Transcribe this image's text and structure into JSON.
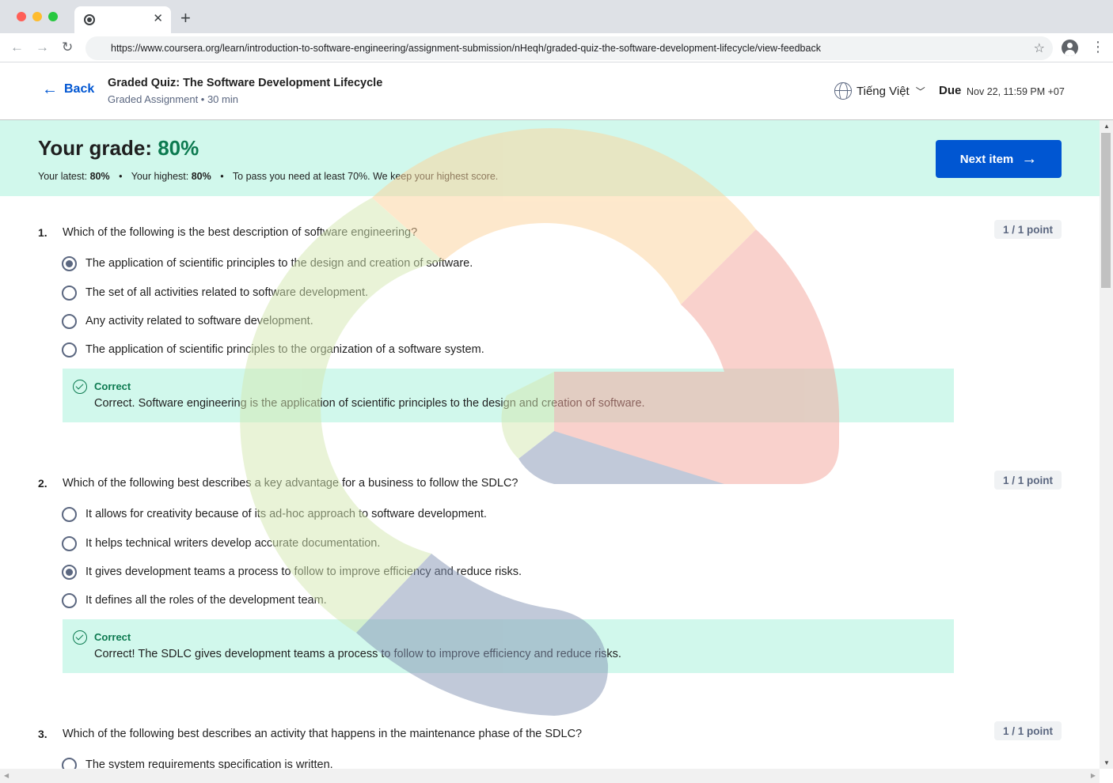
{
  "browser": {
    "url": "https://www.coursera.org/learn/introduction-to-software-engineering/assignment-submission/nHeqh/graded-quiz-the-software-development-lifecycle/view-feedback",
    "tab_close": "✕",
    "new_tab": "+"
  },
  "header": {
    "back_label": "Back",
    "title": "Graded Quiz: The Software Development Lifecycle",
    "subtitle": "Graded Assignment • 30 min",
    "language": "Tiếng Việt",
    "due_label": "Due",
    "due_value": "Nov 22, 11:59 PM +07"
  },
  "grade": {
    "label": "Your grade:",
    "value": "80%",
    "latest_label": "Your latest:",
    "latest_value": "80%",
    "highest_label": "Your highest:",
    "highest_value": "80%",
    "pass_note": "To pass you need at least 70%. We keep your highest score.",
    "separator": "•"
  },
  "next_button": {
    "label": "Next item"
  },
  "questions": [
    {
      "number": "1.",
      "text": "Which of the following is the best description of software engineering?",
      "points": "1 / 1 point",
      "options": [
        "The application of scientific principles to the design and creation of software.",
        "The set of all activities related to software development.",
        "Any activity related to software development.",
        "The application of scientific principles to the organization of a software system."
      ],
      "selected": 0,
      "feedback_title": "Correct",
      "feedback_text": "Correct. Software engineering is the application of scientific principles to the design and creation of software."
    },
    {
      "number": "2.",
      "text": "Which of the following best describes a key advantage for a business to follow the SDLC?",
      "points": "1 / 1 point",
      "options": [
        "It allows for creativity because of its ad-hoc approach to software development.",
        "It helps technical writers develop accurate documentation.",
        "It gives development teams a process to follow to improve efficiency and reduce risks.",
        "It defines all the roles of the development team."
      ],
      "selected": 2,
      "feedback_title": "Correct",
      "feedback_text": "Correct! The SDLC gives development teams a process to follow to improve efficiency and reduce risks."
    },
    {
      "number": "3.",
      "text": "Which of the following best describes an activity that happens in the maintenance phase of the SDLC?",
      "points": "1 / 1 point",
      "options": [
        "The system requirements specification is written."
      ],
      "selected": -1
    }
  ],
  "colors": {
    "accent_blue": "#0056d2",
    "correct_green": "#0c7a50",
    "banner_bg": "#d1f8ec"
  },
  "icons": {
    "back": "arrow-left-icon",
    "next": "arrow-right-icon",
    "language": "globe-icon",
    "correct": "check-circle-icon"
  }
}
